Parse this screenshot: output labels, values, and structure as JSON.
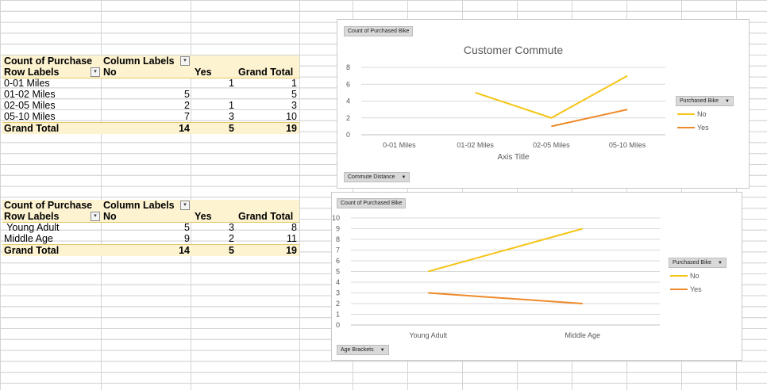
{
  "pivot1": {
    "header": {
      "count": "Count of Purchase",
      "column_labels": "Column Labels"
    },
    "labels_row": {
      "row_labels": "Row Labels",
      "no": "No",
      "yes": "Yes",
      "grand_total": "Grand Total"
    },
    "rows": [
      {
        "label": "0-01 Miles",
        "no": "",
        "yes": "1",
        "total": "1"
      },
      {
        "label": "01-02 Miles",
        "no": "5",
        "yes": "",
        "total": "5"
      },
      {
        "label": "02-05 Miles",
        "no": "2",
        "yes": "1",
        "total": "3"
      },
      {
        "label": "05-10 Miles",
        "no": "7",
        "yes": "3",
        "total": "10"
      }
    ],
    "total_row": {
      "label": "Grand Total",
      "no": "14",
      "yes": "5",
      "total": "19"
    }
  },
  "pivot2": {
    "header": {
      "count": "Count of Purchase",
      "column_labels": "Column Labels"
    },
    "labels_row": {
      "row_labels": "Row Labels",
      "no": "No",
      "yes": "Yes",
      "grand_total": "Grand Total"
    },
    "rows": [
      {
        "label": " Young Adult",
        "no": "5",
        "yes": "3",
        "total": "8"
      },
      {
        "label": "Middle Age",
        "no": "9",
        "yes": "2",
        "total": "11"
      }
    ],
    "total_row": {
      "label": "Grand Total",
      "no": "14",
      "yes": "5",
      "total": "19"
    }
  },
  "chart_data": [
    {
      "type": "line",
      "title": "Customer Commute",
      "xlabel": "Axis Title",
      "ylabel": "",
      "categories": [
        "0-01 Miles",
        "01-02 Miles",
        "02-05 Miles",
        "05-10 Miles"
      ],
      "yticks": [
        "0",
        "2",
        "4",
        "6",
        "8"
      ],
      "ylim": [
        0,
        8
      ],
      "series": [
        {
          "name": "No",
          "values": [
            null,
            5,
            2,
            7
          ],
          "color": "#f5c518"
        },
        {
          "name": "Yes",
          "values": [
            null,
            null,
            1,
            3
          ],
          "color": "#ee8a2a"
        }
      ],
      "value_button": "Count of Purchased Bike",
      "axis_button": "Commute Distance",
      "legend_button": "Purchased Bike",
      "legend_placement": "right",
      "grid": true
    },
    {
      "type": "line",
      "title": "",
      "xlabel": "",
      "ylabel": "",
      "categories": [
        "Young Adult",
        "Middle Age"
      ],
      "yticks": [
        "0",
        "1",
        "2",
        "3",
        "4",
        "5",
        "6",
        "7",
        "8",
        "9",
        "10"
      ],
      "ylim": [
        0,
        10
      ],
      "series": [
        {
          "name": "No",
          "values": [
            5,
            9
          ],
          "color": "#f5c518"
        },
        {
          "name": "Yes",
          "values": [
            3,
            2
          ],
          "color": "#ee8a2a"
        }
      ],
      "value_button": "Count of Purchased Bike",
      "axis_button": "Age Brackets",
      "legend_button": "Purchased Bike",
      "legend_placement": "right",
      "grid": true
    }
  ]
}
